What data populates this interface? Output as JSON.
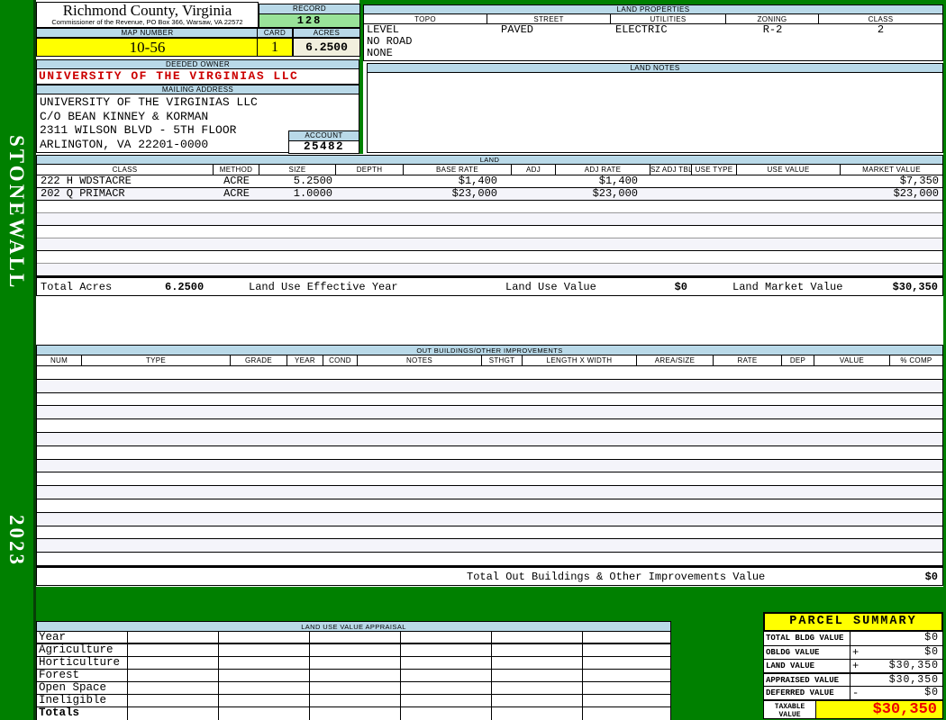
{
  "county": {
    "title": "Richmond County, Virginia",
    "subtitle": "Commissioner of the Revenue, PO Box 366, Warsaw, VA 22572"
  },
  "sidebar": {
    "district": "STONEWALL",
    "year": "2023"
  },
  "record": {
    "label": "RECORD",
    "value": "128"
  },
  "map_number": {
    "label": "MAP NUMBER",
    "value": "10-56"
  },
  "card": {
    "label": "CARD",
    "value": "1"
  },
  "acres": {
    "label": "ACRES",
    "value": "6.2500"
  },
  "land_properties": {
    "title": "LAND PROPERTIES",
    "headers": [
      "TOPO",
      "STREET",
      "UTILITIES",
      "ZONING",
      "CLASS"
    ],
    "values": [
      "LEVEL",
      "PAVED",
      "ELECTRIC",
      "R-2",
      "2"
    ],
    "extra": [
      "NO ROAD",
      "NONE"
    ]
  },
  "deeded_owner": {
    "label": "DEEDED OWNER",
    "value": "UNIVERSITY OF THE VIRGINIAS LLC"
  },
  "mailing_address": {
    "label": "MAILING ADDRESS",
    "lines": [
      "UNIVERSITY OF THE VIRGINIAS LLC",
      "C/O BEAN KINNEY & KORMAN",
      "2311 WILSON BLVD - 5TH FLOOR",
      "ARLINGTON, VA 22201-0000"
    ]
  },
  "account": {
    "label": "ACCOUNT",
    "value": "25482"
  },
  "land_notes": {
    "title": "LAND NOTES"
  },
  "land": {
    "title": "LAND",
    "headers": [
      "CLASS",
      "METHOD",
      "SIZE",
      "DEPTH",
      "BASE RATE",
      "ADJ",
      "ADJ RATE",
      "SZ ADJ TBL",
      "USE TYPE",
      "USE VALUE",
      "MARKET VALUE"
    ],
    "rows": [
      {
        "class": "222 H WDSTACRE",
        "method": "ACRE",
        "size": "5.2500",
        "base_rate": "$1,400",
        "adj_rate": "$1,400",
        "market_value": "$7,350"
      },
      {
        "class": "202 Q PRIMACR",
        "method": "ACRE",
        "size": "1.0000",
        "base_rate": "$23,000",
        "adj_rate": "$23,000",
        "market_value": "$23,000"
      }
    ],
    "totals": {
      "total_acres_label": "Total Acres",
      "total_acres": "6.2500",
      "effective_year_label": "Land Use Effective Year",
      "use_value_label": "Land Use Value",
      "use_value": "$0",
      "market_value_label": "Land Market Value",
      "market_value": "$30,350"
    }
  },
  "out_buildings": {
    "title": "OUT BUILDINGS/OTHER IMPROVEMENTS",
    "headers": [
      "NUM",
      "TYPE",
      "GRADE",
      "YEAR",
      "COND",
      "NOTES",
      "STHGT",
      "LENGTH X WIDTH",
      "AREA/SIZE",
      "RATE",
      "DEP",
      "VALUE",
      "% COMP"
    ],
    "total_label": "Total Out Buildings & Other Improvements Value",
    "total_value": "$0"
  },
  "land_use_appraisal": {
    "title": "LAND USE VALUE APPRAISAL",
    "row_labels": [
      "Year",
      "Agriculture",
      "Horticulture",
      "Forest",
      "Open Space",
      "Ineligible",
      "Totals"
    ]
  },
  "parcel_summary": {
    "title": "PARCEL SUMMARY",
    "rows": [
      {
        "label": "TOTAL BLDG VALUE",
        "op": "",
        "value": "$0"
      },
      {
        "label": "OBLDG VALUE",
        "op": "+",
        "value": "$0"
      },
      {
        "label": "LAND VALUE",
        "op": "+",
        "value": "$30,350"
      },
      {
        "label": "APPRAISED VALUE",
        "op": "",
        "value": "$30,350"
      },
      {
        "label": "DEFERRED VALUE",
        "op": "-",
        "value": "$0"
      }
    ],
    "taxable": {
      "label_line1": "TAXABLE",
      "label_line2": "VALUE",
      "value": "$30,350"
    }
  },
  "colors": {
    "background_green": "#008000",
    "header_blue": "#b9d9e8",
    "highlight_yellow": "#ffff00",
    "record_green": "#99e399",
    "acres_cream": "#f1efdd",
    "owner_red": "#cc0000",
    "taxable_red": "#ee0000"
  }
}
